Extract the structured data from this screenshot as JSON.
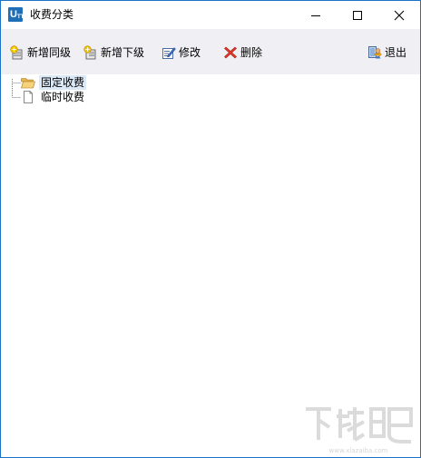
{
  "window": {
    "title": "收费分类",
    "app_icon_text": "U",
    "app_icon_sub": "TT",
    "border_color": "#1a73c8"
  },
  "toolbar": {
    "add_same_label": "新增同级",
    "add_child_label": "新增下级",
    "edit_label": "修改",
    "delete_label": "删除",
    "exit_label": "退出",
    "background": "#f0eff3"
  },
  "tree": {
    "nodes": [
      {
        "label": "固定收费",
        "icon": "folder-open-icon",
        "selected": true
      },
      {
        "label": "临时收费",
        "icon": "document-icon",
        "selected": false
      }
    ],
    "selected_bg": "#dbe8f6"
  },
  "watermark": {
    "logo": "watermark-logo",
    "text": "下载吧",
    "url_text": "www.xiazaiba.com"
  }
}
